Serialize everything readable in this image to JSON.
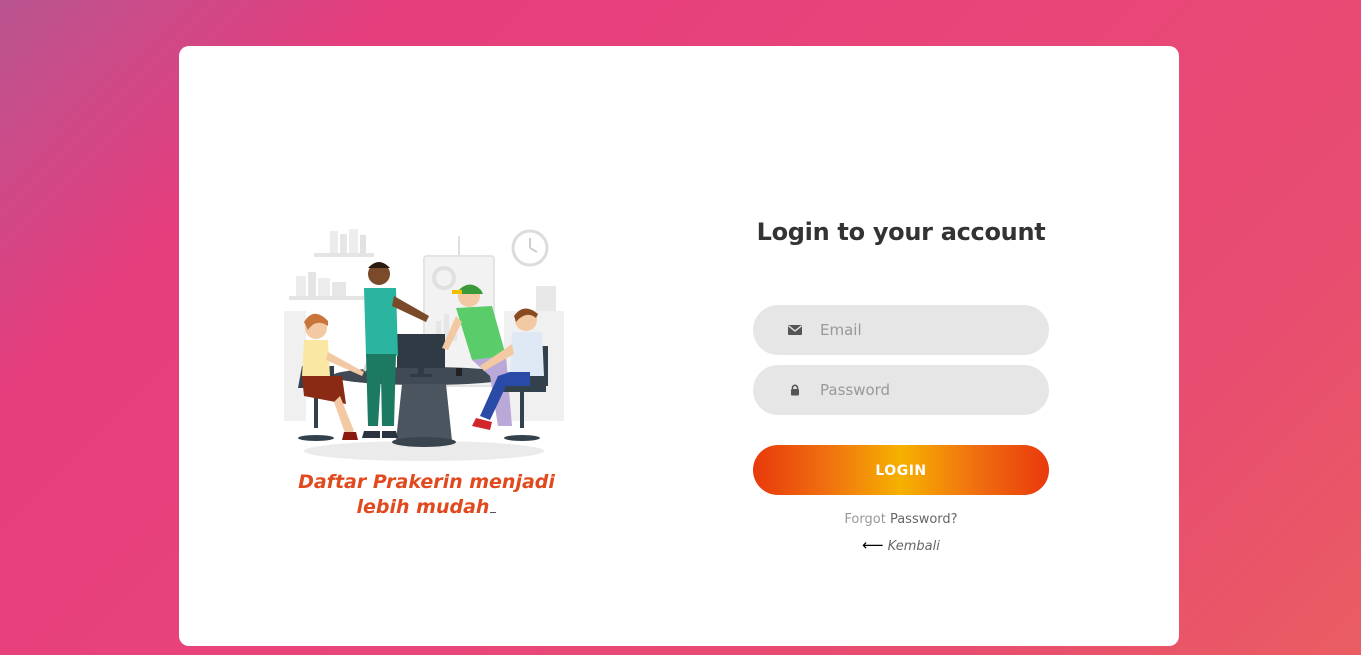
{
  "illustration": {
    "tagline_line1": "Daftar Prakerin menjadi",
    "tagline_line2": "lebih mudah"
  },
  "login": {
    "title": "Login to your account",
    "email_placeholder": "Email",
    "email_icon": "envelope-icon",
    "password_placeholder": "Password",
    "password_icon": "lock-icon",
    "button_label": "LOGIN",
    "forgot_prefix": "Forgot",
    "forgot_link": "Password?",
    "back_arrow": "⟵",
    "back_label": "Kembali"
  },
  "colors": {
    "tagline": "#e14a1e",
    "button_start": "#e8390b",
    "button_mid": "#f6b100",
    "field_bg": "#e6e6e6"
  }
}
